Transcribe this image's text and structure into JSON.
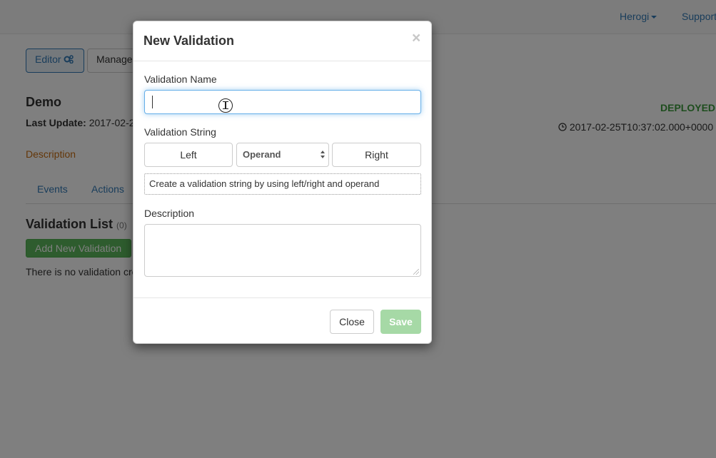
{
  "navbar": {
    "user_menu": "Herogi",
    "support": "Support"
  },
  "page": {
    "editor_button": "Editor",
    "manage_button": "Manage",
    "app_name": "Demo",
    "last_update_label": "Last Update:",
    "last_update_value": "2017-02-2",
    "status": "DEPLOYED",
    "timestamp": "2017-02-25T10:37:02.000+0000",
    "description_link": "Description",
    "tabs": [
      {
        "label": "Events"
      },
      {
        "label": "Actions"
      }
    ],
    "validation_list_title": "Validation List",
    "validation_count": "(0)",
    "add_button": "Add New Validation",
    "empty_text": "There is no validation cre"
  },
  "modal": {
    "title": "New Validation",
    "close_icon": "×",
    "name_label": "Validation Name",
    "name_value": "",
    "string_label": "Validation String",
    "left_button": "Left",
    "operand_select": "Operand",
    "right_button": "Right",
    "validation_string_hint": "Create a validation string by using left/right and operand",
    "description_label": "Description",
    "description_value": "",
    "close_button": "Close",
    "save_button": "Save"
  },
  "colors": {
    "primary": "#337ab7",
    "success": "#5cb85c",
    "deployed": "#3c9a3c",
    "description_link": "#c86d10",
    "save_disabled": "#a6d9a6"
  },
  "icons": {
    "editor": "gears-icon",
    "timestamp": "clock-icon",
    "cursor": "text-cursor-icon"
  }
}
